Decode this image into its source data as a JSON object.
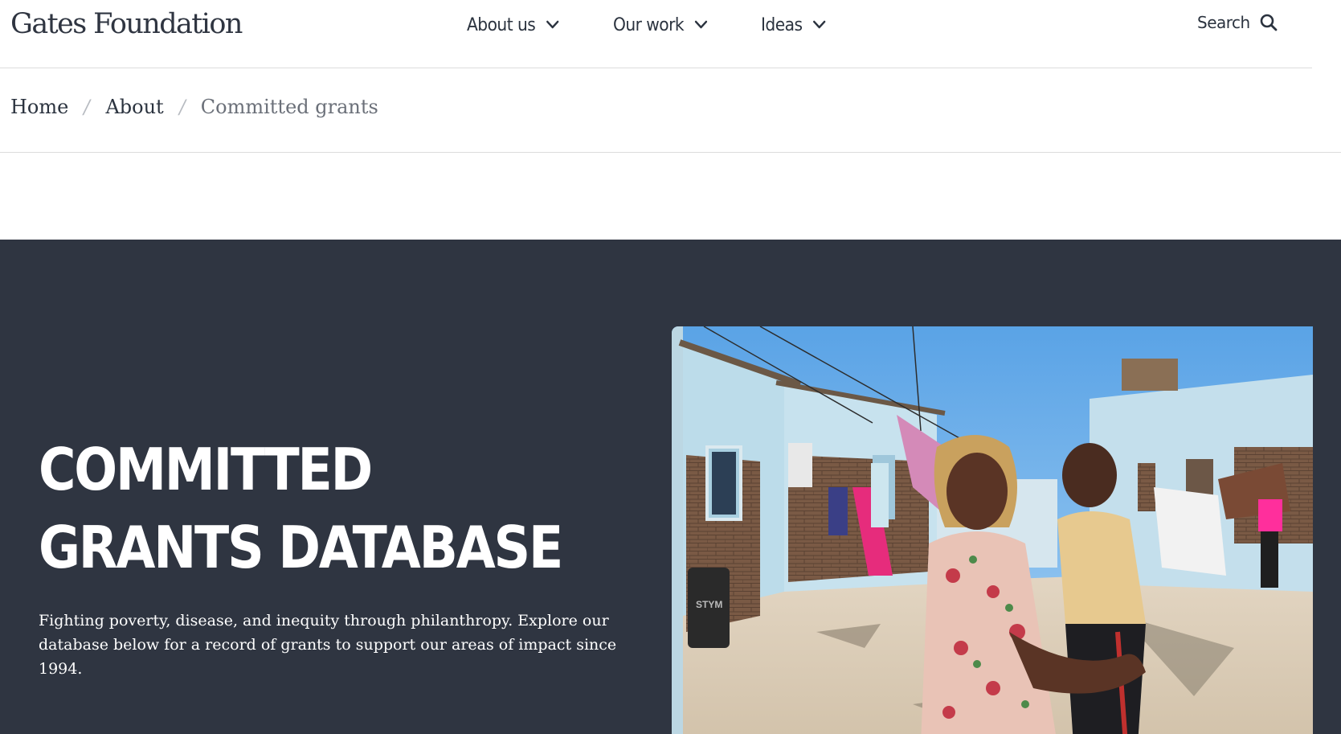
{
  "header": {
    "logo_text": "Gates Foundation",
    "nav": [
      {
        "label": "About us"
      },
      {
        "label": "Our work"
      },
      {
        "label": "Ideas"
      }
    ],
    "search_label": "Search"
  },
  "breadcrumb": {
    "items": [
      "Home",
      "About"
    ],
    "current": "Committed grants"
  },
  "hero": {
    "title": "COMMITTED GRANTS DATABASE",
    "description": "Fighting poverty, disease, and inequity through philanthropy. Explore our database below for a record of grants to support our areas of impact since 1994.",
    "photo_label": "STYM"
  },
  "colors": {
    "hero_background": "#2f3541",
    "text_dark": "#2b333f",
    "breadcrumb_current": "#6b7079",
    "sky": "#6fb1ea"
  }
}
